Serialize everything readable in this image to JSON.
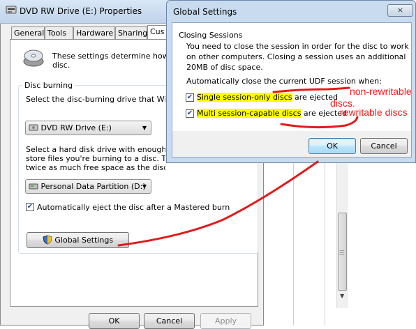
{
  "properties_window": {
    "title": "DVD RW Drive (E:) Properties",
    "tabs": [
      "General",
      "Tools",
      "Hardware",
      "Sharing",
      "Cus"
    ],
    "intro": [
      "These settings determine how Win",
      "disc."
    ],
    "disc_burning": {
      "label": "Disc burning",
      "select_drive_text": "Select the disc-burning drive that Window",
      "drive_value": "DVD RW Drive (E:)",
      "hd_text": [
        "Select a hard disk drive with enough free",
        "store files you're burning to a disc. The dr",
        "twice as much free space as the disc capacity."
      ],
      "partition_value": "Personal Data Partition (D:)",
      "auto_eject_label": "Automatically eject the disc after a Mastered burn",
      "auto_eject_checked": true,
      "global_settings_label": "Global Settings"
    },
    "buttons": {
      "ok": "OK",
      "cancel": "Cancel",
      "apply": "Apply"
    }
  },
  "global_settings_dialog": {
    "title": "Global Settings",
    "close_glyph": "×",
    "section_title": "Closing Sessions",
    "description": [
      "You need to close the session in order for the disc to work",
      "on other computers. Closing a session uses an additional",
      "20MB of disc space."
    ],
    "auto_close_text": "Automatically close the current UDF session when:",
    "option_single": {
      "highlight": "Single session-only discs",
      "rest": " are ejected",
      "checked": true
    },
    "option_multi": {
      "highlight": "Multi session-capable discs",
      "rest": " are ejected",
      "checked": true
    },
    "ok_label": "OK",
    "cancel_label": "Cancel"
  },
  "annotations": {
    "non_rewritable_1": "non-rewritable",
    "non_rewritable_2": "discs.",
    "rewritable": "rewritable discs",
    "color": "#ff1a1a"
  }
}
